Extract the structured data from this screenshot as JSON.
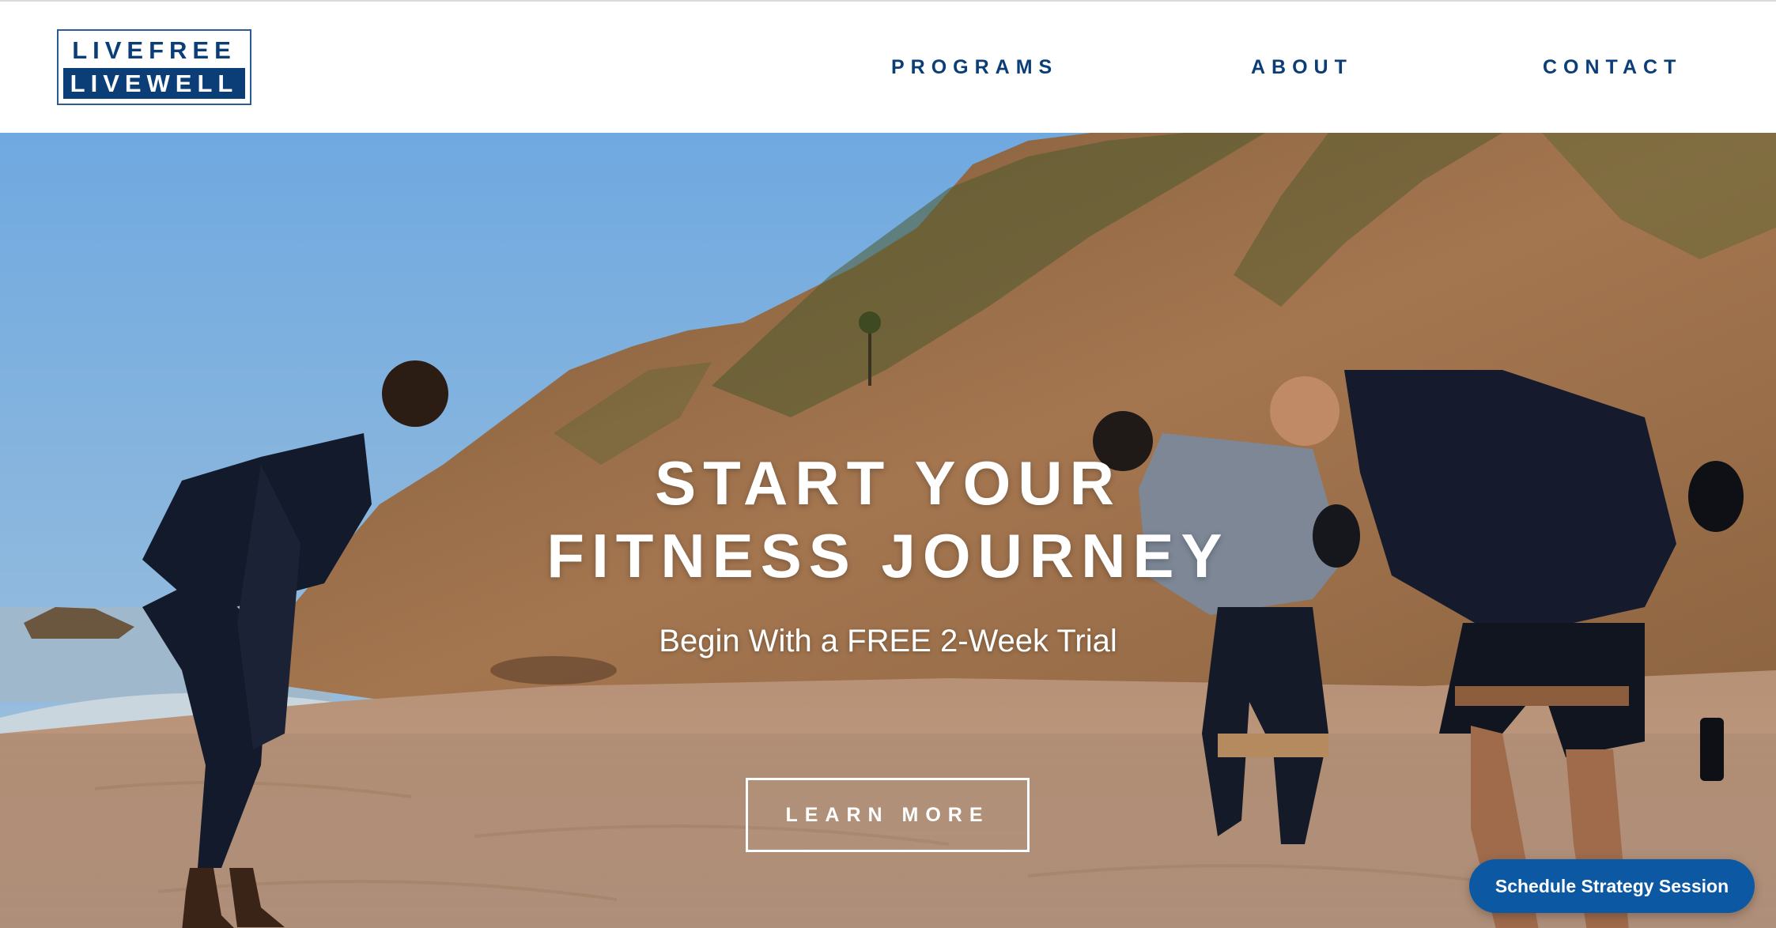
{
  "header": {
    "logo": {
      "line1": "LIVEFREE",
      "line2": "LIVEWELL"
    },
    "nav": [
      {
        "label": "PROGRAMS"
      },
      {
        "label": "ABOUT"
      },
      {
        "label": "CONTACT"
      }
    ]
  },
  "hero": {
    "title_line1": "START YOUR",
    "title_line2": "FITNESS JOURNEY",
    "subtitle": "Begin With a FREE 2-Week Trial",
    "cta_label": "LEARN MORE",
    "background": "beach-workout-photo"
  },
  "widget": {
    "schedule_label": "Schedule Strategy Session"
  },
  "colors": {
    "brand_navy": "#0b3d77",
    "widget_blue": "#0d58a3",
    "sky": "#7ab0de",
    "sand": "#b8947a"
  }
}
